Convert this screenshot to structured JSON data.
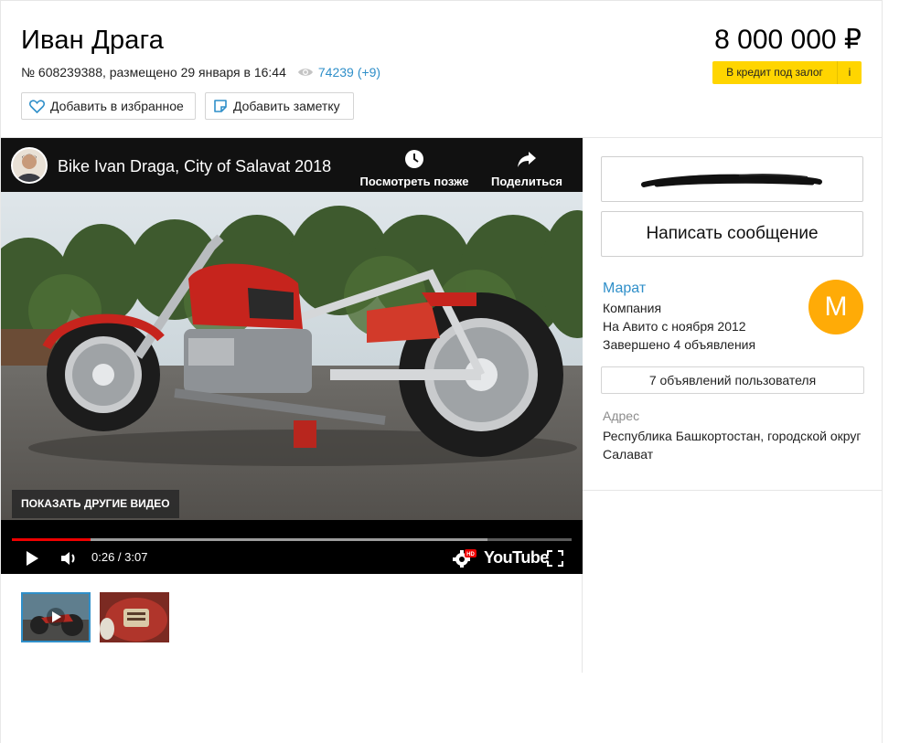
{
  "listing": {
    "title": "Иван Драга",
    "meta_text": "№ 608239388, размещено 29 января в 16:44",
    "views": "74239",
    "views_delta": "(+9)",
    "price": "8 000 000 ₽",
    "credit_label": "В кредит под залог",
    "credit_info": "i",
    "favorite_label": "Добавить в избранное",
    "note_label": "Добавить заметку"
  },
  "video": {
    "title": "Bike Ivan Draga, City of Salavat 2018",
    "watch_later": "Посмотреть позже",
    "share": "Поделиться",
    "more_videos": "ПОКАЗАТЬ ДРУГИЕ ВИДЕО",
    "time": "0:26 / 3:07",
    "brand": "YouTube",
    "hd_badge": "HD",
    "played_fraction": 0.14,
    "loaded_fraction": 0.85
  },
  "seller": {
    "message_label": "Написать сообщение",
    "name": "Марат",
    "type": "Компания",
    "since": "На Авито с ноября 2012",
    "completed": "Завершено 4 объявления",
    "avatar_letter": "М",
    "all_ads_label": "7 объявлений пользователя",
    "address_label": "Адрес",
    "address": "Республика Башкортостан, городской округ Салават"
  },
  "colors": {
    "accent_blue": "#2f8fc9",
    "credit_yellow": "#ffd500",
    "avatar_orange": "#ffab07",
    "progress_red": "#ee0000"
  }
}
